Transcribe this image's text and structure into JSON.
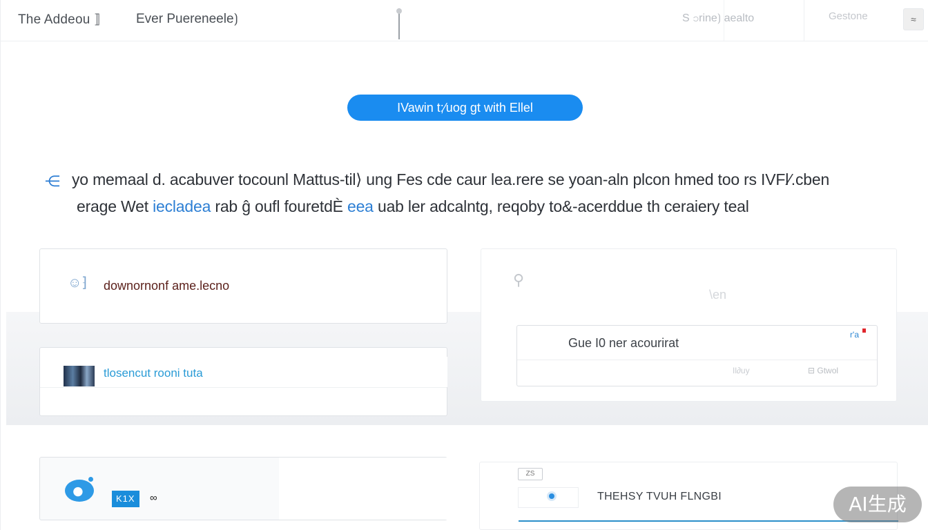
{
  "topbar": {
    "title": "The Addeou ⟧",
    "subtitle": "Ever Puereneele⟯",
    "search_text": "S ၁rine⟯ aealto",
    "settings_text": "Gestone",
    "menu_icon": "wave-menu-icon"
  },
  "cta": {
    "label": "IVawin t;⁄uog gt with Ellel"
  },
  "intro": {
    "line1": "yo memaal d. acabuver tocounl Mattus-til⟩ ung Fes cde caur lea.rere se yoan-aln plcon hmed too rs IVFl⁄.cben",
    "line2_a": "erage Wet ",
    "line2_link1": "iecladea",
    "line2_b": " rab ĝ oufl fouretdÈ ",
    "line2_link2": "eea",
    "line2_c": " uab ler adcalntg, reqoby to&-acerddue th ceraiery teal"
  },
  "cards": {
    "card1": {
      "label": "downornonf ame.lecno",
      "icon": "assistant-icon"
    },
    "card2": {
      "label": "tlosencut rooni tuta",
      "icon": "image-thumbnail"
    },
    "card3": {
      "faint_label": "\\en",
      "field_value": "Gue I0 ner acourirat",
      "field_tag": "r'a",
      "button1": "Il∂uy",
      "button2": "⊟ Gtwol",
      "icon": "person-icon"
    },
    "card4": {
      "badge": "K1X",
      "badge_suffix": "∞",
      "icon": "whale-logo-icon"
    },
    "card5": {
      "chip": "ZS",
      "text": "THEHSY TVUH FLNGBI"
    }
  },
  "watermark": "AI生成"
}
